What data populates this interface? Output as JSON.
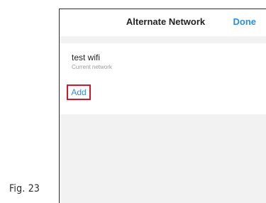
{
  "figure": {
    "label": "Fig. 23"
  },
  "navbar": {
    "title": "Alternate Network",
    "done_label": "Done"
  },
  "network": {
    "name": "test wifi",
    "status": "Current network"
  },
  "actions": {
    "add_label": "Add"
  },
  "colors": {
    "accent": "#2d8ce0",
    "highlight_box": "#d0182c",
    "background": "#f2f2f2"
  }
}
